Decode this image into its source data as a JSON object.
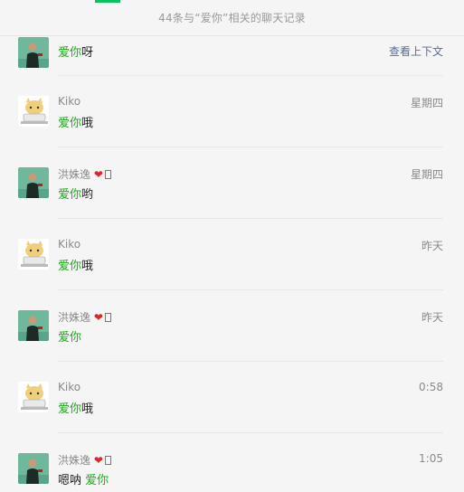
{
  "header": {
    "summary": "44条与“爱你”相关的聊天记录"
  },
  "keyword": "爱你",
  "context_link": "查看上下文",
  "colors": {
    "highlight": "#1aad19",
    "link": "#576b95",
    "accent": "#07c160"
  },
  "messages": [
    {
      "sender": "",
      "heart": "",
      "time": "",
      "pre": "",
      "hl": "爱你",
      "post": "呀",
      "avatar": "green-man"
    },
    {
      "sender": "Kiko",
      "heart": "",
      "time": "星期四",
      "pre": "",
      "hl": "爱你",
      "post": "哦",
      "avatar": "cat"
    },
    {
      "sender": "洪姝逸",
      "heart": "❤",
      "time": "星期四",
      "pre": "",
      "hl": "爱你",
      "post": "哟",
      "avatar": "green-man"
    },
    {
      "sender": "Kiko",
      "heart": "",
      "time": "昨天",
      "pre": "",
      "hl": "爱你",
      "post": "哦",
      "avatar": "cat"
    },
    {
      "sender": "洪姝逸",
      "heart": "❤",
      "time": "昨天",
      "pre": "",
      "hl": "爱你",
      "post": "",
      "avatar": "green-man"
    },
    {
      "sender": "Kiko",
      "heart": "",
      "time": "0:58",
      "pre": "",
      "hl": "爱你",
      "post": "哦",
      "avatar": "cat"
    },
    {
      "sender": "洪姝逸",
      "heart": "❤",
      "time": "1:05",
      "pre": "嗯呐 ",
      "hl": "爱你",
      "post": "",
      "avatar": "green-man"
    }
  ]
}
